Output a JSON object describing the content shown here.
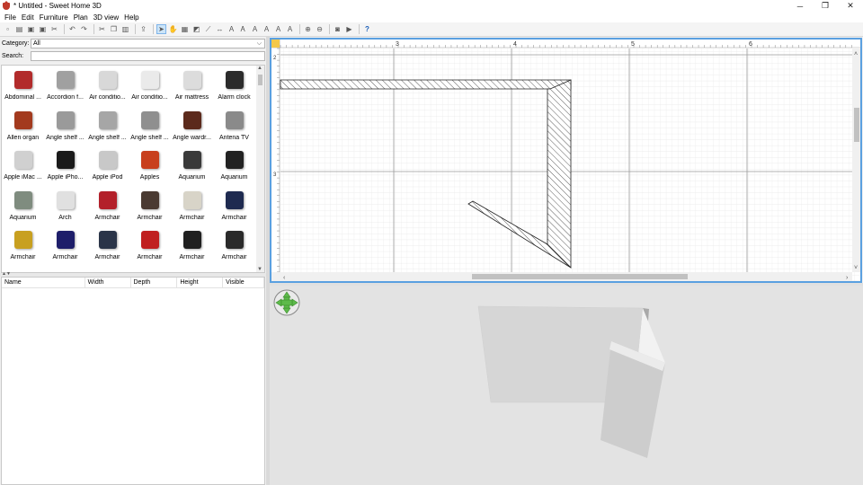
{
  "window": {
    "title": "* Untitled - Sweet Home 3D",
    "minimize": "─",
    "maximize": "❐",
    "close": "✕"
  },
  "menu": [
    "File",
    "Edit",
    "Furniture",
    "Plan",
    "3D view",
    "Help"
  ],
  "toolbar": {
    "icons": [
      "new-icon",
      "open-icon",
      "save-icon",
      "save-as-icon",
      "cut-tool-icon",
      "undo-icon",
      "redo-icon",
      "cut-icon",
      "copy-icon",
      "paste-icon",
      "add-furniture-icon",
      "select-icon",
      "pan-icon",
      "create-walls-icon",
      "create-rooms-icon",
      "create-polylines-icon",
      "create-dimensions-icon",
      "create-labels-icon",
      "text-style-icon",
      "increase-text-icon",
      "decrease-text-icon",
      "bold-icon",
      "italic-icon",
      "zoom-in-icon",
      "zoom-out-icon",
      "create-photo-icon",
      "create-video-icon",
      "help-icon"
    ]
  },
  "catalog": {
    "category_label": "Category:",
    "category_value": "All",
    "search_label": "Search:",
    "search_value": "",
    "items": [
      {
        "name": "Abdominal ...",
        "icon": "abdominal-bench-icon",
        "color": "#b22b2b"
      },
      {
        "name": "Accordion f...",
        "icon": "accordion-folding-door-icon",
        "color": "#a0a0a0"
      },
      {
        "name": "Air conditio...",
        "icon": "air-conditioner-outdoor-icon",
        "color": "#d8d8d8"
      },
      {
        "name": "Air conditio...",
        "icon": "air-conditioner-indoor-icon",
        "color": "#eaeaea"
      },
      {
        "name": "Air mattress",
        "icon": "air-mattress-icon",
        "color": "#dcdcdc"
      },
      {
        "name": "Alarm clock",
        "icon": "alarm-clock-icon",
        "color": "#2b2b2b"
      },
      {
        "name": "Allen organ",
        "icon": "organ-icon",
        "color": "#a33a1e"
      },
      {
        "name": "Angle shelf ...",
        "icon": "angle-shelf-icon",
        "color": "#9a9a9a"
      },
      {
        "name": "Angle shelf ...",
        "icon": "angle-shelf-icon",
        "color": "#a6a6a6"
      },
      {
        "name": "Angle shelf ...",
        "icon": "angle-shelf-icon",
        "color": "#8f8f8f"
      },
      {
        "name": "Angle wardr...",
        "icon": "wardrobe-icon",
        "color": "#5c2a1c"
      },
      {
        "name": "Antena TV",
        "icon": "antenna-icon",
        "color": "#8a8a8a"
      },
      {
        "name": "Apple iMac ...",
        "icon": "imac-icon",
        "color": "#d0d0d0"
      },
      {
        "name": "Apple iPho...",
        "icon": "iphone-icon",
        "color": "#1a1a1a"
      },
      {
        "name": "Apple iPod",
        "icon": "ipod-icon",
        "color": "#c8c8c8"
      },
      {
        "name": "Apples",
        "icon": "apples-icon",
        "color": "#c8401e"
      },
      {
        "name": "Aquarium",
        "icon": "aquarium-icon",
        "color": "#3a3a3a"
      },
      {
        "name": "Aquarium",
        "icon": "aquarium-icon",
        "color": "#222222"
      },
      {
        "name": "Aquarium",
        "icon": "aquarium-icon",
        "color": "#7f8c7f"
      },
      {
        "name": "Arch",
        "icon": "arch-icon",
        "color": "#e0e0e0"
      },
      {
        "name": "Armchair",
        "icon": "armchair-icon",
        "color": "#b3202a"
      },
      {
        "name": "Armchair",
        "icon": "armchair-icon",
        "color": "#4a3a32"
      },
      {
        "name": "Armchair",
        "icon": "armchair-icon",
        "color": "#d8d4c8"
      },
      {
        "name": "Armchair",
        "icon": "armchair-icon",
        "color": "#1e2a50"
      },
      {
        "name": "Armchair",
        "icon": "armchair-icon",
        "color": "#c8a020"
      },
      {
        "name": "Armchair",
        "icon": "armchair-icon",
        "color": "#1e1e6a"
      },
      {
        "name": "Armchair",
        "icon": "armchair-icon",
        "color": "#2a3448"
      },
      {
        "name": "Armchair",
        "icon": "armchair-icon",
        "color": "#c02020"
      },
      {
        "name": "Armchair",
        "icon": "armchair-icon",
        "color": "#202020"
      },
      {
        "name": "Armchair",
        "icon": "armchair-icon",
        "color": "#2a2a2a"
      }
    ]
  },
  "furniture_table": {
    "columns": [
      "Name",
      "Width",
      "Depth",
      "Height",
      "Visible"
    ]
  },
  "plan": {
    "ruler_top": [
      "3",
      "4",
      "5",
      "6"
    ],
    "ruler_left": [
      "2",
      "3"
    ]
  }
}
